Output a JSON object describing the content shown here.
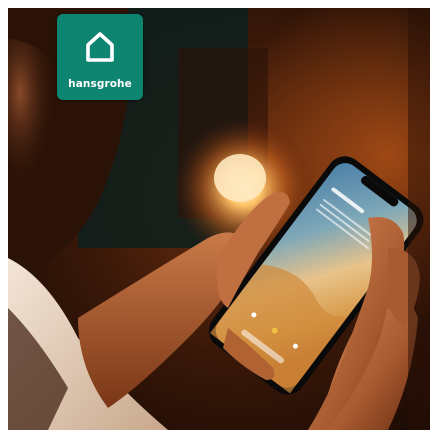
{
  "brand": {
    "name": "hansgrohe",
    "badge_color": "#0e8571"
  },
  "logo_icon": "house-outline-icon",
  "photo": {
    "subject_icon": "smartphone-in-hands-image"
  }
}
